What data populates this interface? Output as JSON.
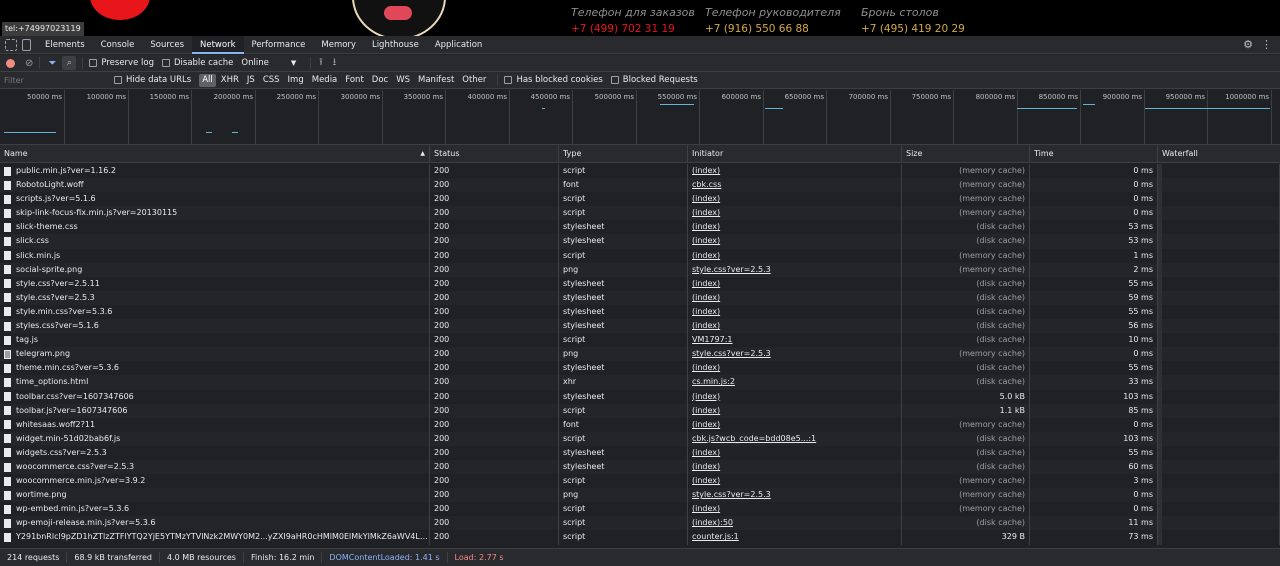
{
  "site": {
    "tooltip": "tel:+74997023119",
    "phones": [
      {
        "caption": "Телефон для заказов",
        "number": "+7 (499) 702 31 19",
        "color": "#e8161b"
      },
      {
        "caption": "Телефон руководителя",
        "number": "+7 (916) 550 66 88",
        "color": "#d4a84a"
      },
      {
        "caption": "Бронь столов",
        "number": "+7 (495) 419 20 29",
        "color": "#d4a84a"
      }
    ]
  },
  "devtools": {
    "tabs": [
      "Elements",
      "Console",
      "Sources",
      "Network",
      "Performance",
      "Memory",
      "Lighthouse",
      "Application"
    ],
    "active_tab": "Network"
  },
  "toolbar": {
    "preserve_log": "Preserve log",
    "disable_cache": "Disable cache",
    "throttle": "Online"
  },
  "filter": {
    "placeholder": "Filter",
    "hide_data_urls": "Hide data URLs",
    "types": [
      "All",
      "XHR",
      "JS",
      "CSS",
      "Img",
      "Media",
      "Font",
      "Doc",
      "WS",
      "Manifest",
      "Other"
    ],
    "active_type": "All",
    "has_blocked_cookies": "Has blocked cookies",
    "blocked_requests": "Blocked Requests"
  },
  "overview": {
    "ticks": [
      "50000 ms",
      "100000 ms",
      "150000 ms",
      "200000 ms",
      "250000 ms",
      "300000 ms",
      "350000 ms",
      "400000 ms",
      "450000 ms",
      "500000 ms",
      "550000 ms",
      "600000 ms",
      "650000 ms",
      "700000 ms",
      "750000 ms",
      "800000 ms",
      "850000 ms",
      "900000 ms",
      "950000 ms",
      "1000000 ms"
    ]
  },
  "table": {
    "headers": {
      "name": "Name",
      "status": "Status",
      "type": "Type",
      "initiator": "Initiator",
      "size": "Size",
      "time": "Time",
      "waterfall": "Waterfall"
    },
    "rows": [
      {
        "name": "public.min.js?ver=1.16.2",
        "status": "200",
        "type": "script",
        "initiator": "(index)",
        "size": "(memory cache)",
        "time": "0 ms"
      },
      {
        "name": "RobotoLight.woff",
        "status": "200",
        "type": "font",
        "initiator": "cbk.css",
        "size": "(memory cache)",
        "time": "0 ms"
      },
      {
        "name": "scripts.js?ver=5.1.6",
        "status": "200",
        "type": "script",
        "initiator": "(index)",
        "size": "(memory cache)",
        "time": "0 ms"
      },
      {
        "name": "skip-link-focus-fix.min.js?ver=20130115",
        "status": "200",
        "type": "script",
        "initiator": "(index)",
        "size": "(memory cache)",
        "time": "0 ms"
      },
      {
        "name": "slick-theme.css",
        "status": "200",
        "type": "stylesheet",
        "initiator": "(index)",
        "size": "(disk cache)",
        "time": "53 ms"
      },
      {
        "name": "slick.css",
        "status": "200",
        "type": "stylesheet",
        "initiator": "(index)",
        "size": "(disk cache)",
        "time": "53 ms"
      },
      {
        "name": "slick.min.js",
        "status": "200",
        "type": "script",
        "initiator": "(index)",
        "size": "(memory cache)",
        "time": "1 ms"
      },
      {
        "name": "social-sprite.png",
        "status": "200",
        "type": "png",
        "initiator": "style.css?ver=2.5.3",
        "size": "(memory cache)",
        "time": "2 ms"
      },
      {
        "name": "style.css?ver=2.5.11",
        "status": "200",
        "type": "stylesheet",
        "initiator": "(index)",
        "size": "(disk cache)",
        "time": "55 ms"
      },
      {
        "name": "style.css?ver=2.5.3",
        "status": "200",
        "type": "stylesheet",
        "initiator": "(index)",
        "size": "(disk cache)",
        "time": "59 ms"
      },
      {
        "name": "style.min.css?ver=5.3.6",
        "status": "200",
        "type": "stylesheet",
        "initiator": "(index)",
        "size": "(disk cache)",
        "time": "55 ms"
      },
      {
        "name": "styles.css?ver=5.1.6",
        "status": "200",
        "type": "stylesheet",
        "initiator": "(index)",
        "size": "(disk cache)",
        "time": "56 ms"
      },
      {
        "name": "tag.js",
        "status": "200",
        "type": "script",
        "initiator": "VM1797:1",
        "size": "(disk cache)",
        "time": "10 ms"
      },
      {
        "name": "telegram.png",
        "status": "200",
        "type": "png",
        "initiator": "style.css?ver=2.5.3",
        "size": "(memory cache)",
        "time": "0 ms",
        "img": true
      },
      {
        "name": "theme.min.css?ver=5.3.6",
        "status": "200",
        "type": "stylesheet",
        "initiator": "(index)",
        "size": "(disk cache)",
        "time": "55 ms"
      },
      {
        "name": "time_options.html",
        "status": "200",
        "type": "xhr",
        "initiator": "cs.min.js:2",
        "size": "(disk cache)",
        "time": "33 ms"
      },
      {
        "name": "toolbar.css?ver=1607347606",
        "status": "200",
        "type": "stylesheet",
        "initiator": "(index)",
        "size": "5.0 kB",
        "time": "103 ms",
        "num": true
      },
      {
        "name": "toolbar.js?ver=1607347606",
        "status": "200",
        "type": "script",
        "initiator": "(index)",
        "size": "1.1 kB",
        "time": "85 ms",
        "num": true
      },
      {
        "name": "whitesaas.woff2?11",
        "status": "200",
        "type": "font",
        "initiator": "(index)",
        "size": "(memory cache)",
        "time": "0 ms"
      },
      {
        "name": "widget.min-51d02bab6f.js",
        "status": "200",
        "type": "script",
        "initiator": "cbk.js?wcb_code=bdd08e5...:1",
        "size": "(disk cache)",
        "time": "103 ms"
      },
      {
        "name": "widgets.css?ver=2.5.3",
        "status": "200",
        "type": "stylesheet",
        "initiator": "(index)",
        "size": "(disk cache)",
        "time": "55 ms"
      },
      {
        "name": "woocommerce.css?ver=2.5.3",
        "status": "200",
        "type": "stylesheet",
        "initiator": "(index)",
        "size": "(disk cache)",
        "time": "60 ms"
      },
      {
        "name": "woocommerce.min.js?ver=3.9.2",
        "status": "200",
        "type": "script",
        "initiator": "(index)",
        "size": "(memory cache)",
        "time": "3 ms"
      },
      {
        "name": "wortime.png",
        "status": "200",
        "type": "png",
        "initiator": "style.css?ver=2.5.3",
        "size": "(memory cache)",
        "time": "0 ms"
      },
      {
        "name": "wp-embed.min.js?ver=5.3.6",
        "status": "200",
        "type": "script",
        "initiator": "(index)",
        "size": "(memory cache)",
        "time": "0 ms"
      },
      {
        "name": "wp-emoji-release.min.js?ver=5.3.6",
        "status": "200",
        "type": "script",
        "initiator": "(index):50",
        "size": "(disk cache)",
        "time": "11 ms"
      },
      {
        "name": "Y291bnRlcl9pZD1hZTlzZTFlYTQ2YjE5YTMzYTVlNzk2MWY0M2...yZXI9aHR0cHMlM0ElMkYlMkZ6aWV4LmJpdHUpe...",
        "status": "200",
        "type": "script",
        "initiator": "counter.js:1",
        "size": "329 B",
        "time": "73 ms",
        "num": true
      }
    ]
  },
  "statusbar": {
    "requests": "214 requests",
    "transferred": "68.9 kB transferred",
    "resources": "4.0 MB resources",
    "finish": "Finish: 16.2 min",
    "dcl": "DOMContentLoaded: 1.41 s",
    "load": "Load: 2.77 s"
  }
}
